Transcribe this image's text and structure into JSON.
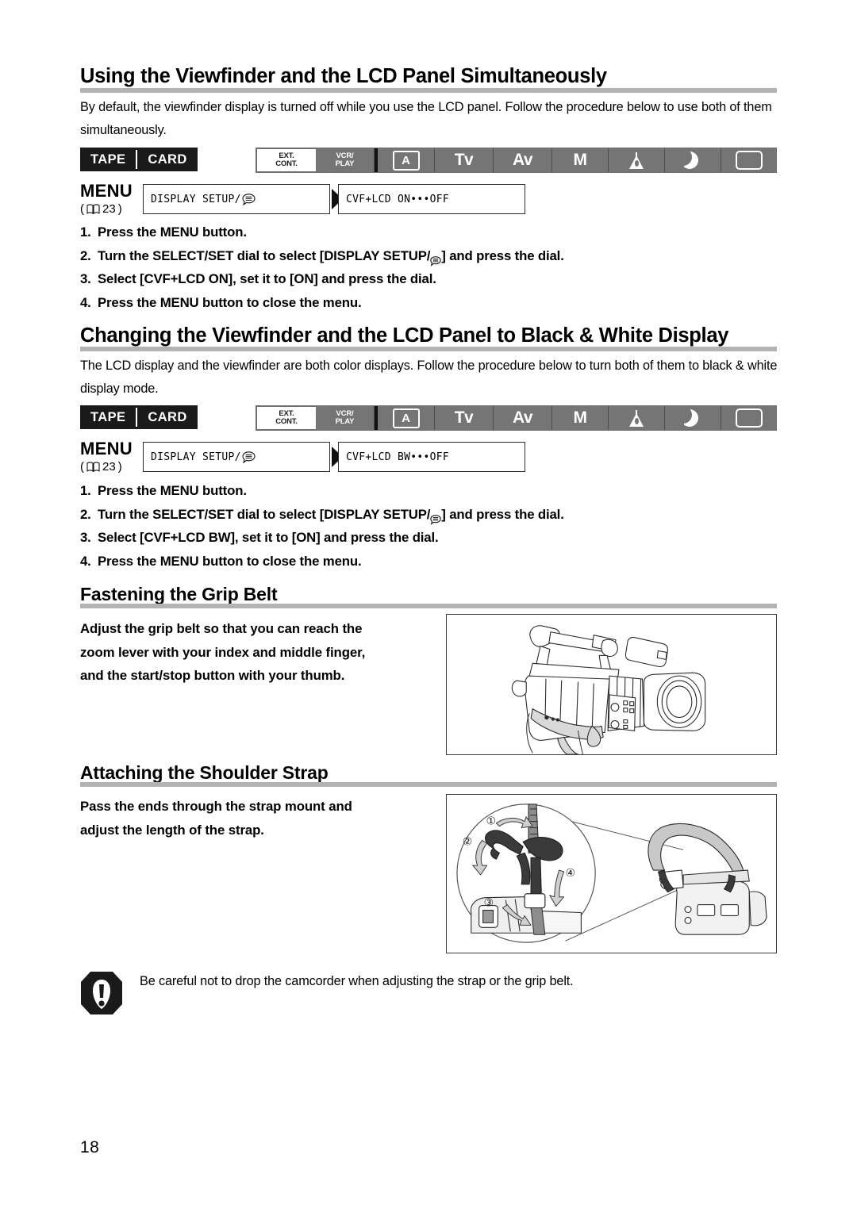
{
  "page": {
    "number": "18"
  },
  "section1": {
    "heading": "Using the Viewfinder and the LCD Panel Simultaneously",
    "intro": "By default, the viewfinder display is turned off while you use the LCD panel. Follow the procedure below to use both of them simultaneously.",
    "tape_label": "TAPE",
    "card_label": "CARD",
    "modes": [
      {
        "name": "ext-cont",
        "line1": "EXT.",
        "line2": "CONT.",
        "style": "white"
      },
      {
        "name": "vcr-play",
        "line1": "VCR/",
        "line2": "PLAY",
        "style": "gray"
      },
      {
        "name": "auto",
        "icon": "boxed-a-icon",
        "label": "A",
        "style": "gray"
      },
      {
        "name": "tv",
        "label": "Tv",
        "style": "gray"
      },
      {
        "name": "av",
        "label": "Av",
        "style": "gray"
      },
      {
        "name": "manual",
        "label": "M",
        "style": "gray"
      },
      {
        "name": "spotlight",
        "icon": "spotlight-icon",
        "style": "gray"
      },
      {
        "name": "night",
        "icon": "moon-icon",
        "style": "gray"
      },
      {
        "name": "screen",
        "icon": "rounded-rect-icon",
        "style": "gray"
      }
    ],
    "menu_label": "MENU",
    "menu_ref": "23",
    "menu_box_1": "DISPLAY SETUP/",
    "menu_box_2": "CVF+LCD ON•••OFF",
    "steps": [
      {
        "num": "1.",
        "text": "Press the MENU button."
      },
      {
        "num": "2.",
        "text_before": "Turn the SELECT/SET dial to select [DISPLAY SETUP/",
        "text_after": "] and press the dial."
      },
      {
        "num": "3.",
        "text": "Select [CVF+LCD ON], set it to [ON] and press the dial."
      },
      {
        "num": "4.",
        "text": "Press the MENU button to close the menu."
      }
    ]
  },
  "section2": {
    "heading": "Changing the Viewfinder and the LCD Panel to Black & White Display",
    "intro": "The LCD display and the viewfinder are both color displays. Follow the procedure below to turn both of them to black & white display mode.",
    "tape_label": "TAPE",
    "card_label": "CARD",
    "modes": [
      {
        "name": "ext-cont",
        "line1": "EXT.",
        "line2": "CONT.",
        "style": "white"
      },
      {
        "name": "vcr-play",
        "line1": "VCR/",
        "line2": "PLAY",
        "style": "gray"
      },
      {
        "name": "auto",
        "icon": "boxed-a-icon",
        "label": "A",
        "style": "gray"
      },
      {
        "name": "tv",
        "label": "Tv",
        "style": "gray"
      },
      {
        "name": "av",
        "label": "Av",
        "style": "gray"
      },
      {
        "name": "manual",
        "label": "M",
        "style": "gray"
      },
      {
        "name": "spotlight",
        "icon": "spotlight-icon",
        "style": "gray"
      },
      {
        "name": "night",
        "icon": "moon-icon",
        "style": "gray"
      },
      {
        "name": "screen",
        "icon": "rounded-rect-icon",
        "style": "gray"
      }
    ],
    "menu_label": "MENU",
    "menu_ref": "23",
    "menu_box_1": "DISPLAY SETUP/",
    "menu_box_2": "CVF+LCD BW•••OFF",
    "steps": [
      {
        "num": "1.",
        "text": "Press the MENU button."
      },
      {
        "num": "2.",
        "text_before": "Turn the SELECT/SET dial to select [DISPLAY SETUP/",
        "text_after": "] and press the dial."
      },
      {
        "num": "3.",
        "text": "Select [CVF+LCD BW], set it to [ON] and press the dial."
      },
      {
        "num": "4.",
        "text": "Press the MENU button to close the menu."
      }
    ]
  },
  "section3": {
    "heading": "Fastening the Grip Belt",
    "body_line1": "Adjust the grip belt so that you can reach the",
    "body_line2": "zoom lever with your index and middle finger,",
    "body_line3": "and the start/stop button with your thumb.",
    "figure_name": "camcorder-grip-belt-illustration"
  },
  "section4": {
    "heading": "Attaching the Shoulder Strap",
    "body_line1": "Pass the ends through the strap mount and",
    "body_line2": "adjust the length of the strap.",
    "figure_name": "shoulder-strap-illustration",
    "callouts": [
      "①",
      "②",
      "③",
      "④"
    ]
  },
  "caution": {
    "text": "Be careful not to drop the camcorder when adjusting the strap or the grip belt."
  },
  "colors": {
    "heading_rule": "#b3b3b3",
    "mode_cell": "#757575",
    "chip_bg": "#1a1a1a",
    "text": "#000000"
  }
}
